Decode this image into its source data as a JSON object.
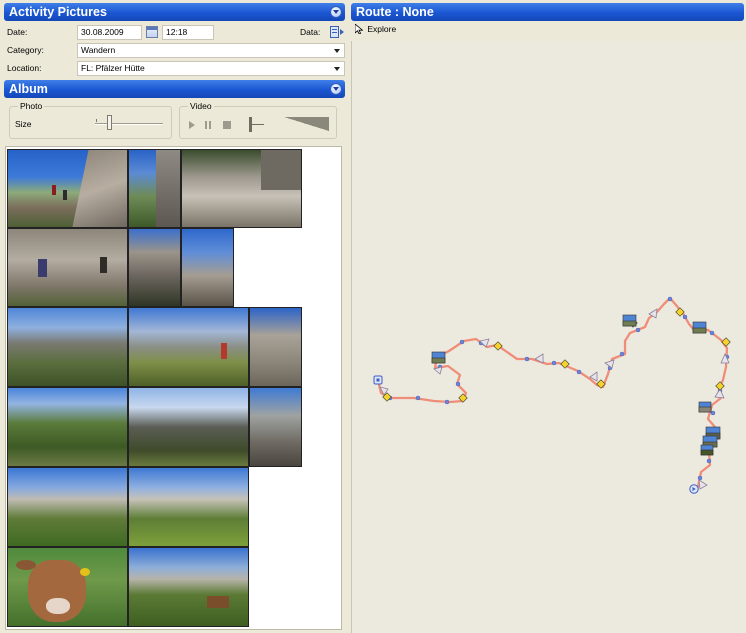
{
  "activity_pictures": {
    "title": "Activity Pictures",
    "date_label": "Date:",
    "date_value": "30.08.2009",
    "time_value": "12:18",
    "data_label": "Data:",
    "category_label": "Category:",
    "category_value": "Wandern",
    "location_label": "Location:",
    "location_value": "FL: Pfälzer Hütte"
  },
  "album": {
    "title": "Album",
    "photo_group": "Photo",
    "size_label": "Size",
    "video_group": "Video"
  },
  "route": {
    "title": "Route : None",
    "explore_label": "Explore"
  },
  "colors": {
    "header_blue": "#1b56d2",
    "route_line": "#f08d78",
    "route_point": "#6f86d8"
  },
  "photos": [
    {
      "row": 1,
      "count": 3,
      "scene": "mountain-hikers"
    },
    {
      "row": 2,
      "count": 3,
      "scene": "rocky-trail"
    },
    {
      "row": 3,
      "count": 3,
      "scene": "mountain-panorama"
    },
    {
      "row": 4,
      "count": 3,
      "scene": "green-valley"
    },
    {
      "row": 5,
      "count": 2,
      "scene": "rocky-ridge"
    },
    {
      "row": 6,
      "count": 2,
      "scene": "cows"
    }
  ]
}
